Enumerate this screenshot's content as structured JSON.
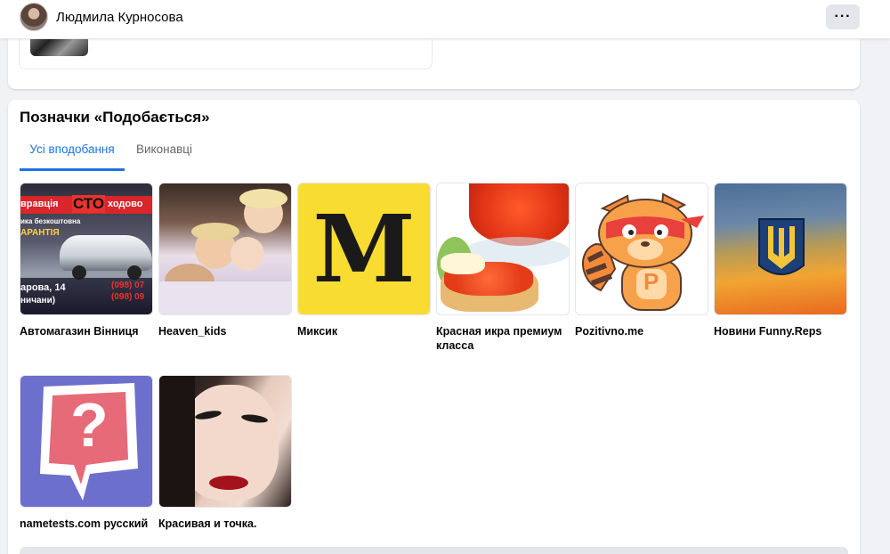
{
  "header": {
    "profile_name": "Людмила Курносова",
    "more_label": "···"
  },
  "likes": {
    "title": "Позначки «Подобається»",
    "tabs": [
      {
        "label": "Усі вподобання",
        "active": true
      },
      {
        "label": "Виконавці",
        "active": false
      }
    ],
    "items": [
      {
        "name": "Автомагазин Вінниця",
        "thumb_text": [
          "вравція",
          "СТО",
          "ходово",
          "ика безкоштовна",
          "АРАНТІЯ",
          "(098) 07",
          "арова, 14",
          "(098) 09",
          "ничани)"
        ]
      },
      {
        "name": "Heaven_kids"
      },
      {
        "name": "Миксик",
        "thumb_text": [
          "M"
        ]
      },
      {
        "name": "Красная икра премиум класса"
      },
      {
        "name": "Pozitivno.me",
        "thumb_text": [
          "P"
        ]
      },
      {
        "name": "Новини Funny.Reps"
      },
      {
        "name": "nametests.com русский",
        "thumb_text": [
          "?"
        ]
      },
      {
        "name": "Красивая и точка."
      }
    ]
  },
  "colors": {
    "accent": "#1b74e4",
    "miksik_yellow": "#f9dc31",
    "nametests_purple": "#6d6fcc"
  }
}
